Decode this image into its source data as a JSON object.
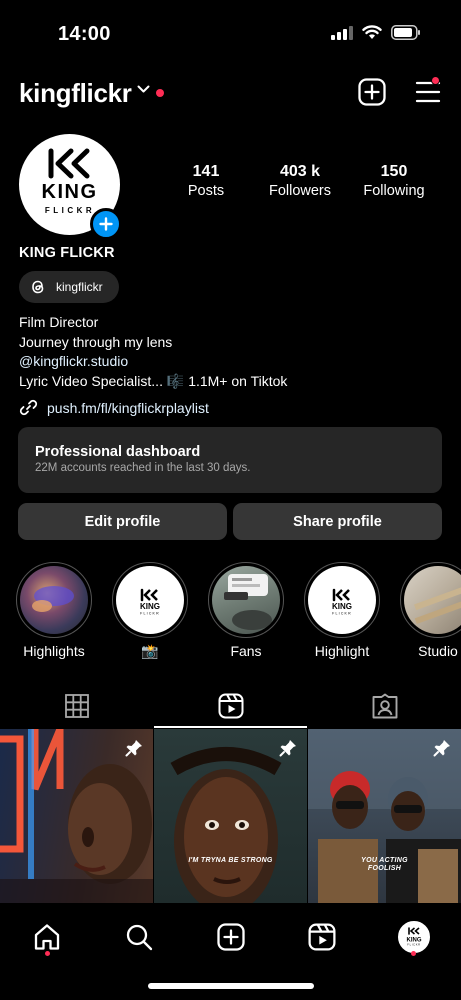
{
  "status_bar": {
    "time": "14:00"
  },
  "header": {
    "username": "kingflickr"
  },
  "profile": {
    "avatar_logo_line1": "KING",
    "avatar_logo_line2": "FLICKR",
    "stats": [
      {
        "value": "141",
        "label": "Posts"
      },
      {
        "value": "403 k",
        "label": "Followers"
      },
      {
        "value": "150",
        "label": "Following"
      }
    ],
    "display_name": "KING FLICKR",
    "threads_handle": "kingflickr",
    "bio": {
      "line1": "Film Director",
      "line2": "Journey through my lens",
      "line3": "@kingflickr.studio",
      "line4_text": "Lyric Video Specialist...",
      "line4_emoji": "🎼",
      "line4_suffix": "1.1M+ on Tiktok"
    },
    "link": "push.fm/fl/kingflickrplaylist"
  },
  "dashboard": {
    "title": "Professional dashboard",
    "subtitle": "22M accounts reached in the last 30 days."
  },
  "buttons": {
    "edit": "Edit profile",
    "share": "Share profile"
  },
  "highlights": [
    {
      "label": "Highlights"
    },
    {
      "label": "📸"
    },
    {
      "label": "Fans"
    },
    {
      "label": "Highlight"
    },
    {
      "label": "Studio"
    }
  ],
  "tabs": {
    "active": "reels"
  },
  "grid": [
    {
      "caption": ""
    },
    {
      "caption": "I'M TRYNA BE STRONG"
    },
    {
      "caption_line1": "YOU ACTING",
      "caption_line2": "FOOLISH"
    }
  ],
  "colors": {
    "accent_blue": "#0095f6",
    "notification_red": "#ff2d55",
    "button_gray": "#363636",
    "card_gray": "#262626"
  }
}
